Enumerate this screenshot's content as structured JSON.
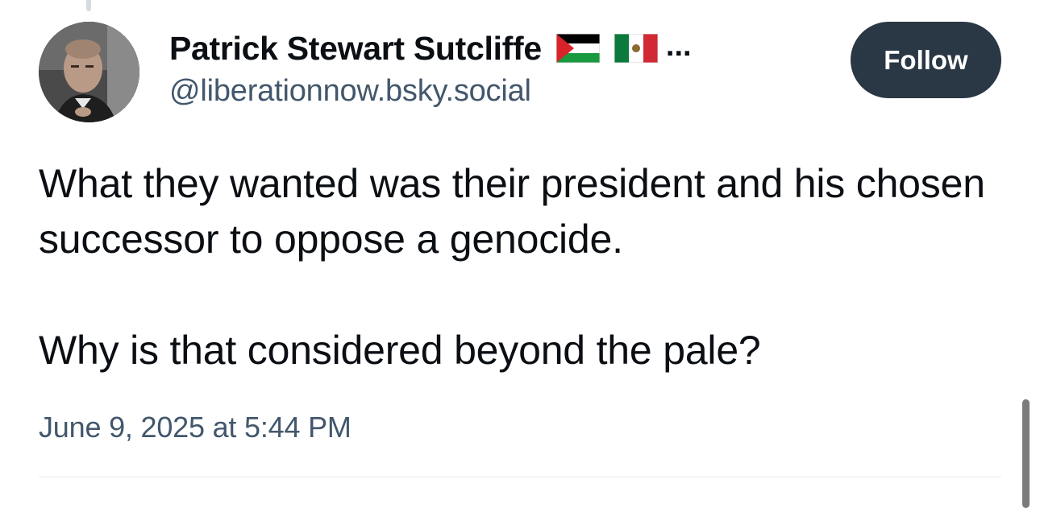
{
  "post": {
    "author": {
      "display_name": "Patrick Stewart Sutcliffe",
      "flags": [
        "palestine-flag-icon",
        "mexico-flag-icon"
      ],
      "name_truncation": "...",
      "handle": "@liberationnow.bsky.social"
    },
    "follow_label": "Follow",
    "text_paragraphs": [
      "What they wanted was their president and his chosen successor to oppose a genocide.",
      "Why is that considered beyond the pale?"
    ],
    "timestamp": "June 9, 2025 at 5:44 PM"
  },
  "colors": {
    "follow_button_bg": "#2a3744",
    "secondary_text": "#42576c",
    "primary_text": "#0b0f14",
    "divider": "#e3e8ed"
  }
}
